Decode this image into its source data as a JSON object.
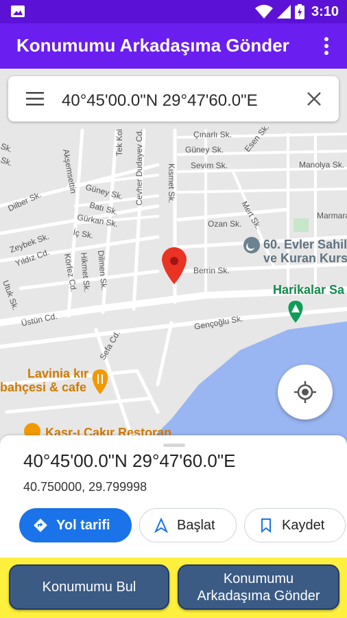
{
  "status_bar": {
    "time": "3:10"
  },
  "app_bar": {
    "title": "Konumumu Arkadaşıma Gönder"
  },
  "search": {
    "value": "40°45'00.0\"N 29°47'60.0\"E"
  },
  "map": {
    "streets": [
      "Akşemsettin",
      "Tek Kol",
      "Cevher Dudayev Cd.",
      "Kısmet Sk.",
      "Çınarlı Sk.",
      "Güney Sk.",
      "Sevim Sk.",
      "Esen Sk.",
      "Manolya Sk.",
      "Marmara",
      "Mert Sk.",
      "Ozan Sk.",
      "Berrin Sk.",
      "Güney Sk.",
      "Batı Sk.",
      "Gürkan Sk.",
      "İç Sk.",
      "Dilber Sk.",
      "Zeybek Sk.",
      "Yıldız Cd.",
      "Körfez Cd.",
      "Hikmet Sk.",
      "Dilmen Sk.",
      "Utuk Sk.",
      "Üstün Cd.",
      "Gençoğlu Sk.",
      "Sefa Cd.",
      "Sk.",
      "Sk."
    ],
    "pois": {
      "mosque": [
        "60. Evler Sahil",
        "ve Kuran Kursu"
      ],
      "park": "Harikalar Sa",
      "restaurant1": [
        "Lavinia kır",
        "bahçesi & cafe"
      ],
      "restaurant2": "Kasr-ı Çakır Restoran"
    },
    "colors": {
      "water": "#9ab6f2",
      "land": "#e8e8e8",
      "road": "#ffffff",
      "pin": "#ea3323",
      "park_green": "#0f9d58",
      "mosque_gray": "#6b8290",
      "food_orange": "#f29900"
    }
  },
  "place": {
    "title": "40°45'00.0\"N 29°47'60.0\"E",
    "coords": "40.750000, 29.799998",
    "actions": {
      "directions": "Yol tarifi",
      "start": "Başlat",
      "save": "Kaydet"
    }
  },
  "buttons": {
    "find": "Konumumu Bul",
    "send_line1": "Konumumu",
    "send_line2": "Arkadaşıma Gönder"
  },
  "colors": {
    "status_bar": "#5b12d6",
    "app_bar": "#6a1ef0",
    "primary_chip": "#1a73e8",
    "bottom_bar": "#fff03d",
    "big_button": "#3b5b85"
  }
}
